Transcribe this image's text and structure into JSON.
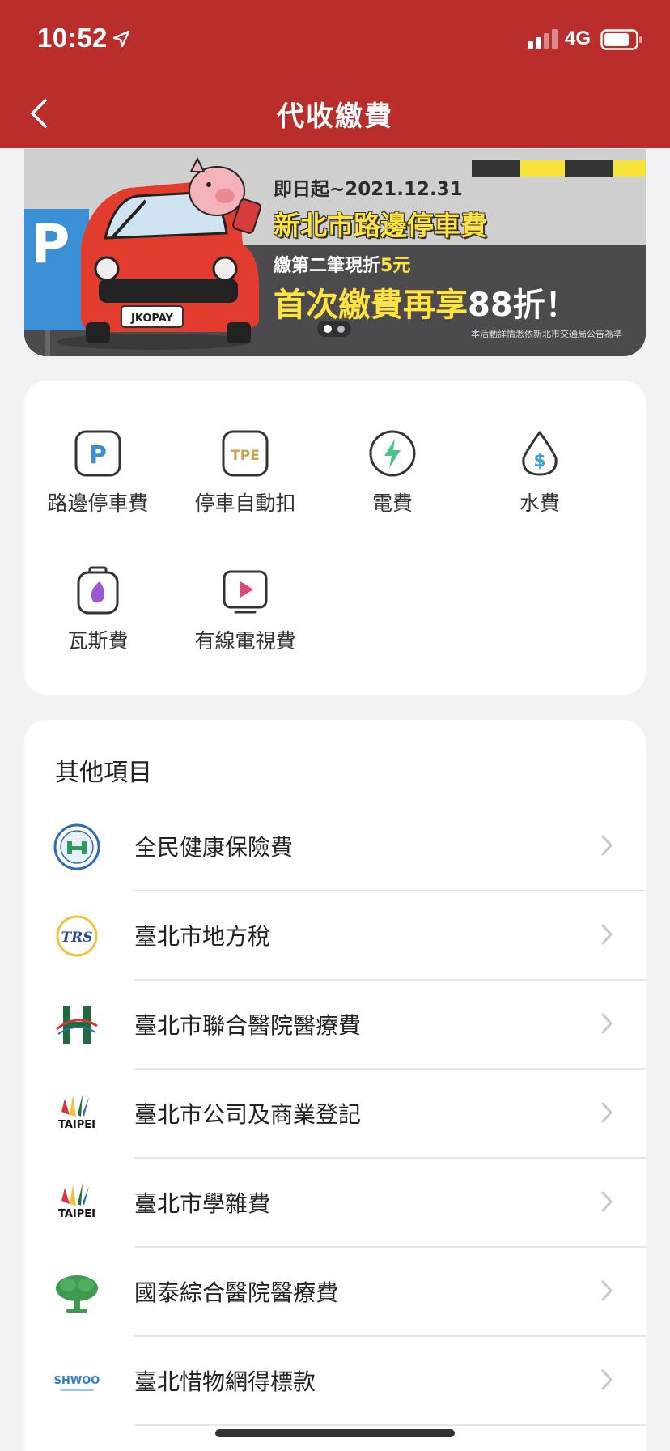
{
  "status_bar": {
    "time": "10:52",
    "network": "4G"
  },
  "header": {
    "title": "代收繳費"
  },
  "banner": {
    "date": "即日起~2021.12.31",
    "headline": "新北市路邊停車費",
    "sub_prefix": "繳第二筆現折",
    "sub_amount": "5元",
    "big_prefix": "首次繳費再享",
    "big_discount": "88折！",
    "note": "本活動詳情悉依新北市交通局公告為準",
    "plate": "JKOPAY",
    "parking_letter": "P",
    "page_count": 2,
    "page_index": 1
  },
  "categories": [
    {
      "label": "路邊停車費",
      "icon": "parking-icon"
    },
    {
      "label": "停車自動扣",
      "icon": "tpe-parking-icon",
      "icon_text": "TPE"
    },
    {
      "label": "電費",
      "icon": "electricity-icon"
    },
    {
      "label": "水費",
      "icon": "water-icon"
    },
    {
      "label": "瓦斯費",
      "icon": "gas-icon"
    },
    {
      "label": "有線電視費",
      "icon": "cable-tv-icon"
    }
  ],
  "other": {
    "title": "其他項目",
    "items": [
      {
        "label": "全民健康保險費",
        "logo": "nhi-logo"
      },
      {
        "label": "臺北市地方稅",
        "logo": "tpe-tax-logo",
        "logo_text": "TRS"
      },
      {
        "label": "臺北市聯合醫院醫療費",
        "logo": "tpe-hospital-logo"
      },
      {
        "label": "臺北市公司及商業登記",
        "logo": "taipei-city-logo",
        "logo_text": "TAIPEI"
      },
      {
        "label": "臺北市學雜費",
        "logo": "taipei-city-logo",
        "logo_text": "TAIPEI"
      },
      {
        "label": "國泰綜合醫院醫療費",
        "logo": "cathay-hospital-logo"
      },
      {
        "label": "臺北惜物網得標款",
        "logo": "shwoo-logo",
        "logo_text": "SHWOO"
      }
    ]
  },
  "colors": {
    "brand_red": "#b92d2b",
    "banner_yellow": "#ffe33f",
    "parking_blue": "#3b8fd4"
  }
}
